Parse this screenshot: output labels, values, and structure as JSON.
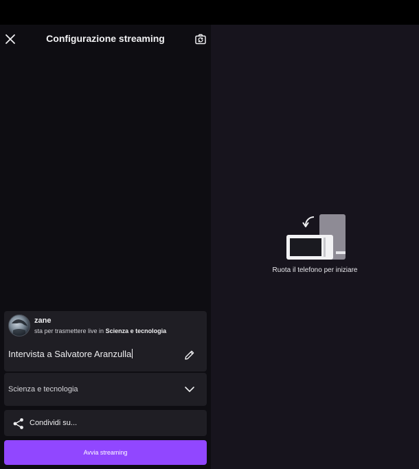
{
  "header": {
    "title": "Configurazione streaming",
    "close_icon": "close-icon",
    "flip_icon": "camera-flip-icon"
  },
  "user": {
    "name": "zane",
    "status_prefix": "sta per trasmettere live in",
    "status_category": "Scienza e tecnologia"
  },
  "stream": {
    "title_value": "Intervista a Salvatore Aranzulla",
    "edit_icon": "pencil-icon",
    "category": "Scienza e tecnologia",
    "category_icon": "chevron-down-icon"
  },
  "share": {
    "label": "Condividi su...",
    "icon": "share-icon"
  },
  "actions": {
    "start_label": "Avvia streaming"
  },
  "preview": {
    "rotate_message": "Ruota il telefono per iniziare",
    "illustration_icon": "rotate-phone-icon"
  },
  "colors": {
    "accent": "#9147ff",
    "card": "#1f1e24",
    "panel_left": "#0e0d12",
    "panel_right": "#17141d"
  }
}
